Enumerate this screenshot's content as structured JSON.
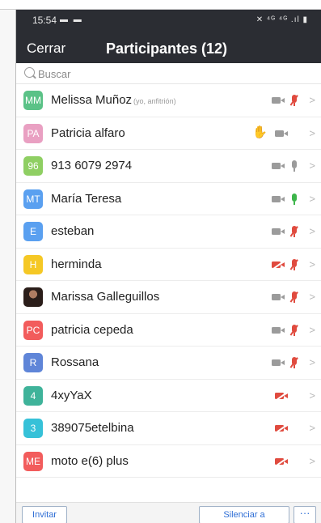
{
  "status_bar": {
    "time": "15:54",
    "notification_icons": "▬ ▬",
    "right_icons": "✕ ⁴ᴳ ⁴ᴳ .ıl ▮"
  },
  "header": {
    "close_label": "Cerrar",
    "title": "Participantes (12)",
    "background": "#2b2d33"
  },
  "search": {
    "placeholder": "Buscar"
  },
  "participants": [
    {
      "initials": "MM",
      "name": "Melissa Muñoz",
      "role": "(yo, anfitrión)",
      "color": "#5bc287",
      "video": "on",
      "audio": "muted",
      "hand": false
    },
    {
      "initials": "PA",
      "name": "Patricia alfaro",
      "role": "",
      "color": "#e9a0c2",
      "video": "on",
      "audio": "none",
      "hand": true
    },
    {
      "initials": "96",
      "name": "913 6079 2974",
      "role": "",
      "color": "#8fcf63",
      "video": "on",
      "audio": "on-idle",
      "hand": false
    },
    {
      "initials": "MT",
      "name": "María Teresa",
      "role": "",
      "color": "#5aa0f0",
      "video": "on",
      "audio": "on-active",
      "hand": false
    },
    {
      "initials": "E",
      "name": "esteban",
      "role": "",
      "color": "#5aa0f0",
      "video": "on",
      "audio": "muted",
      "hand": false
    },
    {
      "initials": "H",
      "name": "herminda",
      "role": "",
      "color": "#f5c825",
      "video": "off",
      "audio": "muted",
      "hand": false
    },
    {
      "initials": "",
      "name": "Marissa Galleguillos",
      "role": "",
      "color": "#3a2a24",
      "video": "on",
      "audio": "muted",
      "hand": false,
      "photo": true
    },
    {
      "initials": "PC",
      "name": "patricia cepeda",
      "role": "",
      "color": "#f25c5c",
      "video": "on",
      "audio": "muted",
      "hand": false
    },
    {
      "initials": "R",
      "name": "Rossana",
      "role": "",
      "color": "#5f85d8",
      "video": "on",
      "audio": "muted",
      "hand": false
    },
    {
      "initials": "4",
      "name": "4xyYaX",
      "role": "",
      "color": "#3fb39a",
      "video": "off",
      "audio": "none",
      "hand": false
    },
    {
      "initials": "3",
      "name": "389075etelbina",
      "role": "",
      "color": "#36c1d8",
      "video": "off",
      "audio": "none",
      "hand": false
    },
    {
      "initials": "ME",
      "name": "moto e(6) plus",
      "role": "",
      "color": "#f25c5c",
      "video": "off",
      "audio": "none",
      "hand": false
    }
  ],
  "footer": {
    "invite_label": "Invitar",
    "mute_all_label": "Silenciar a",
    "more_label": "···"
  },
  "icons": {
    "search": "search-icon",
    "video": "video-camera-icon",
    "video_off": "video-off-icon",
    "mic": "microphone-icon",
    "mic_muted": "microphone-muted-icon",
    "hand": "raised-hand-icon",
    "chevron": "chevron-right-icon"
  },
  "colors": {
    "muted_red": "#e04b3f",
    "speaking_green": "#3cb54a",
    "icon_gray": "#9b9b9b",
    "link_blue": "#2f6fd6"
  }
}
